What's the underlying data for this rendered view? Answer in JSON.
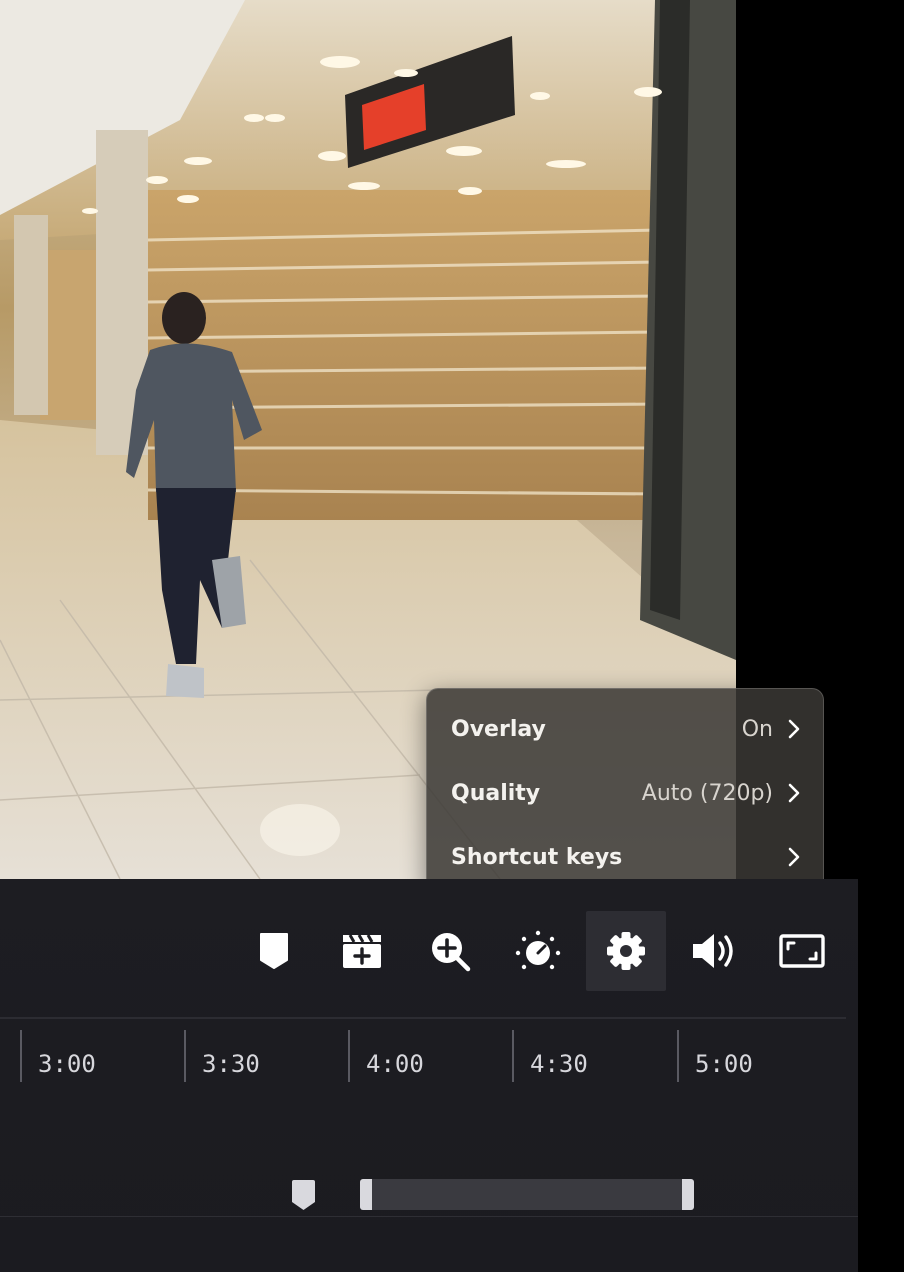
{
  "settings_menu": {
    "items": [
      {
        "label": "Overlay",
        "value": "On"
      },
      {
        "label": "Quality",
        "value": "Auto (720p)"
      },
      {
        "label": "Shortcut keys",
        "value": ""
      }
    ]
  },
  "toolbar": {
    "buttons": [
      {
        "name": "bookmark",
        "icon": "bookmark-icon"
      },
      {
        "name": "add-clip",
        "icon": "clapperboard-plus-icon"
      },
      {
        "name": "zoom-in",
        "icon": "zoom-in-icon"
      },
      {
        "name": "brightness",
        "icon": "brightness-dial-icon"
      },
      {
        "name": "settings",
        "icon": "gear-icon",
        "active": true
      },
      {
        "name": "volume",
        "icon": "volume-icon"
      },
      {
        "name": "fullscreen",
        "icon": "fullscreen-icon"
      }
    ]
  },
  "timeline": {
    "ticks": [
      "3:00",
      "3:30",
      "4:00",
      "4:30",
      "5:00"
    ]
  },
  "colors": {
    "panel_bg": "#1d1d22",
    "menu_bg": "#3a3834",
    "icon": "#ffffff",
    "active_button_bg": "#2d2d33"
  }
}
